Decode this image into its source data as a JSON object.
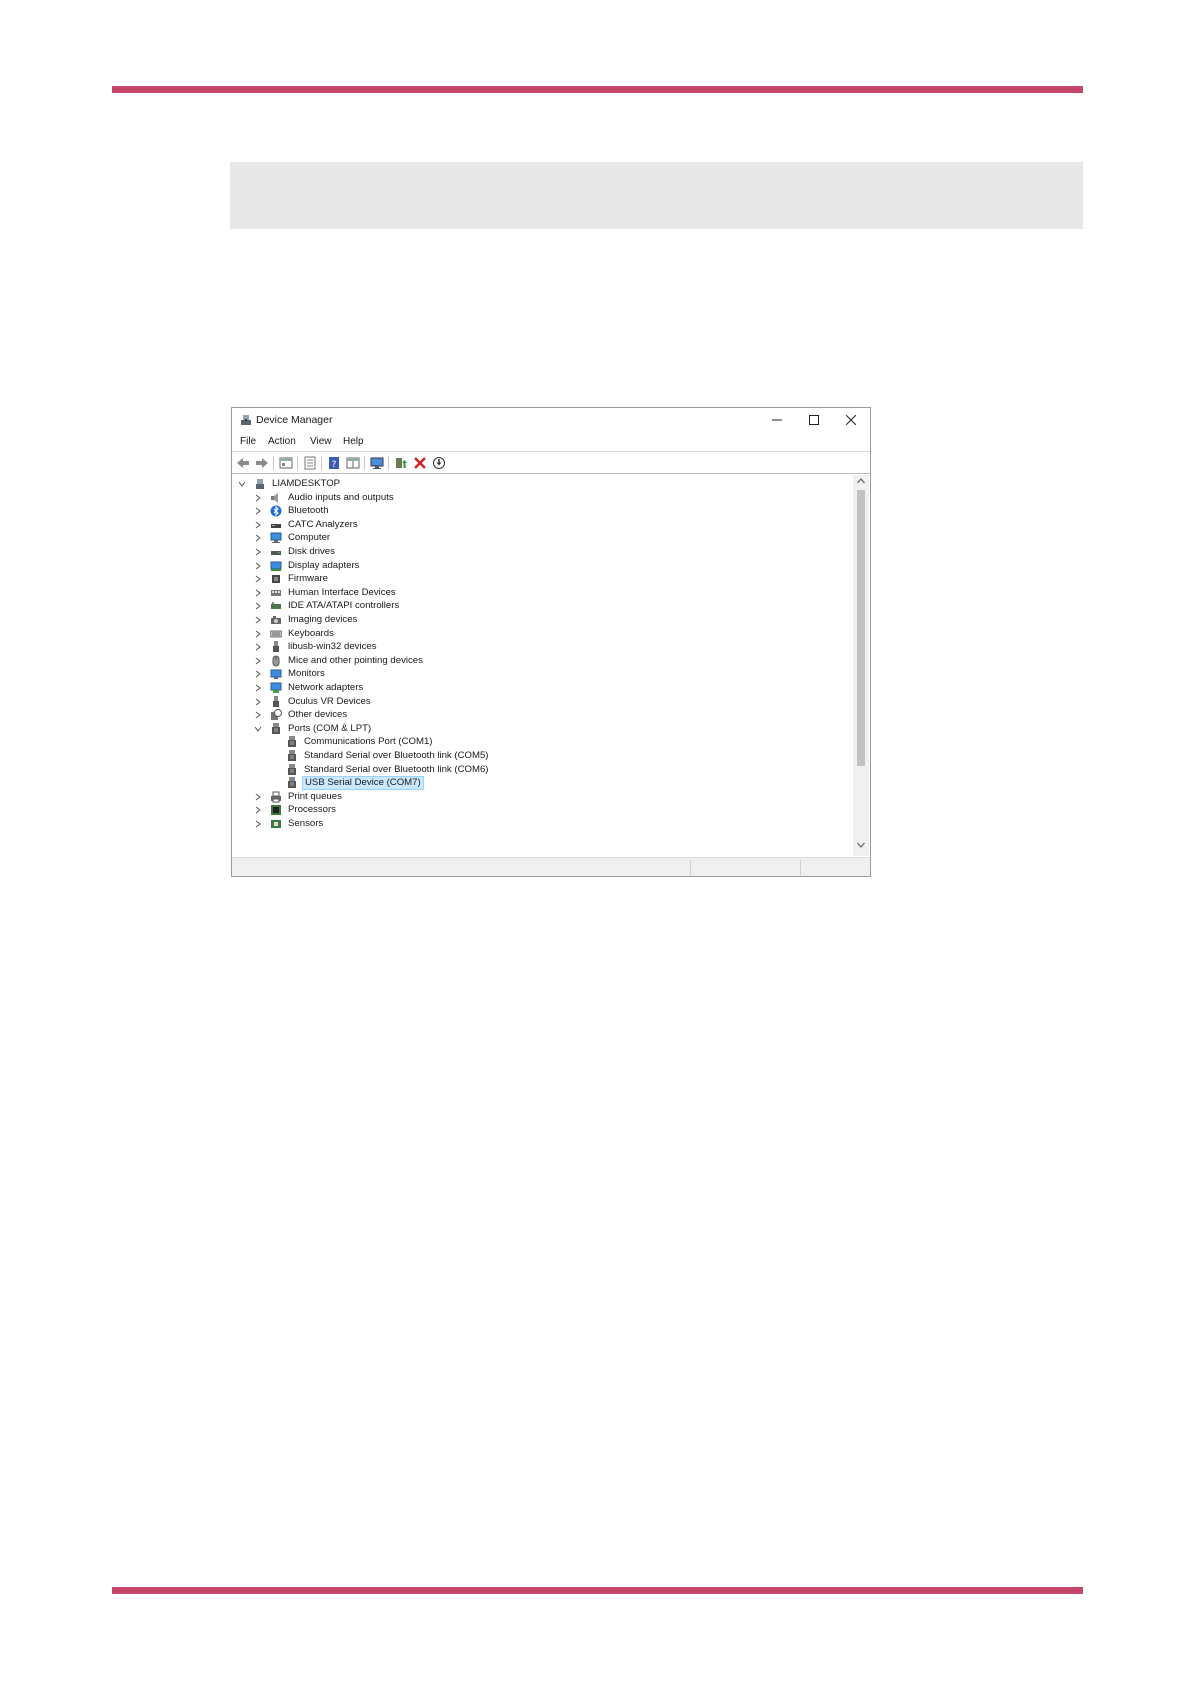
{
  "colors": {
    "accent": "#c6456b",
    "selection": "#cce8ff"
  },
  "window": {
    "title": "Device Manager",
    "app_icon": "device-manager-icon",
    "controls": [
      "minimize-icon",
      "maximize-icon",
      "close-icon"
    ]
  },
  "menu": {
    "file": "File",
    "action": "Action",
    "view": "View",
    "help": "Help"
  },
  "toolbar": [
    "back-icon",
    "forward-icon",
    "properties-icon",
    "details-icon",
    "help-icon",
    "panel-icon",
    "monitor-icon",
    "update-driver-icon",
    "uninstall-icon",
    "download-icon"
  ],
  "tree": {
    "root": "LIAMDESKTOP",
    "categories": [
      {
        "label": "Audio inputs and outputs",
        "icon": "speaker-icon"
      },
      {
        "label": "Bluetooth",
        "icon": "bluetooth-icon"
      },
      {
        "label": "CATC Analyzers",
        "icon": "analyzer-icon"
      },
      {
        "label": "Computer",
        "icon": "computer-icon"
      },
      {
        "label": "Disk drives",
        "icon": "disk-icon"
      },
      {
        "label": "Display adapters",
        "icon": "display-adapter-icon"
      },
      {
        "label": "Firmware",
        "icon": "chip-icon"
      },
      {
        "label": "Human Interface Devices",
        "icon": "hid-icon"
      },
      {
        "label": "IDE ATA/ATAPI controllers",
        "icon": "ide-icon"
      },
      {
        "label": "Imaging devices",
        "icon": "camera-icon"
      },
      {
        "label": "Keyboards",
        "icon": "keyboard-icon"
      },
      {
        "label": "libusb-win32 devices",
        "icon": "usb-icon"
      },
      {
        "label": "Mice and other pointing devices",
        "icon": "mouse-icon"
      },
      {
        "label": "Monitors",
        "icon": "monitor-icon"
      },
      {
        "label": "Network adapters",
        "icon": "network-icon"
      },
      {
        "label": "Oculus VR Devices",
        "icon": "usb-icon"
      },
      {
        "label": "Other devices",
        "icon": "unknown-device-icon"
      },
      {
        "label": "Ports (COM & LPT)",
        "icon": "port-icon",
        "expanded": true,
        "children": [
          "Communications Port (COM1)",
          "Standard Serial over Bluetooth link (COM5)",
          "Standard Serial over Bluetooth link (COM6)",
          "USB Serial Device (COM7)"
        ],
        "selected_child": 3
      },
      {
        "label": "Print queues",
        "icon": "printer-icon"
      },
      {
        "label": "Processors",
        "icon": "processor-icon"
      },
      {
        "label": "Sensors",
        "icon": "sensor-icon"
      }
    ]
  }
}
